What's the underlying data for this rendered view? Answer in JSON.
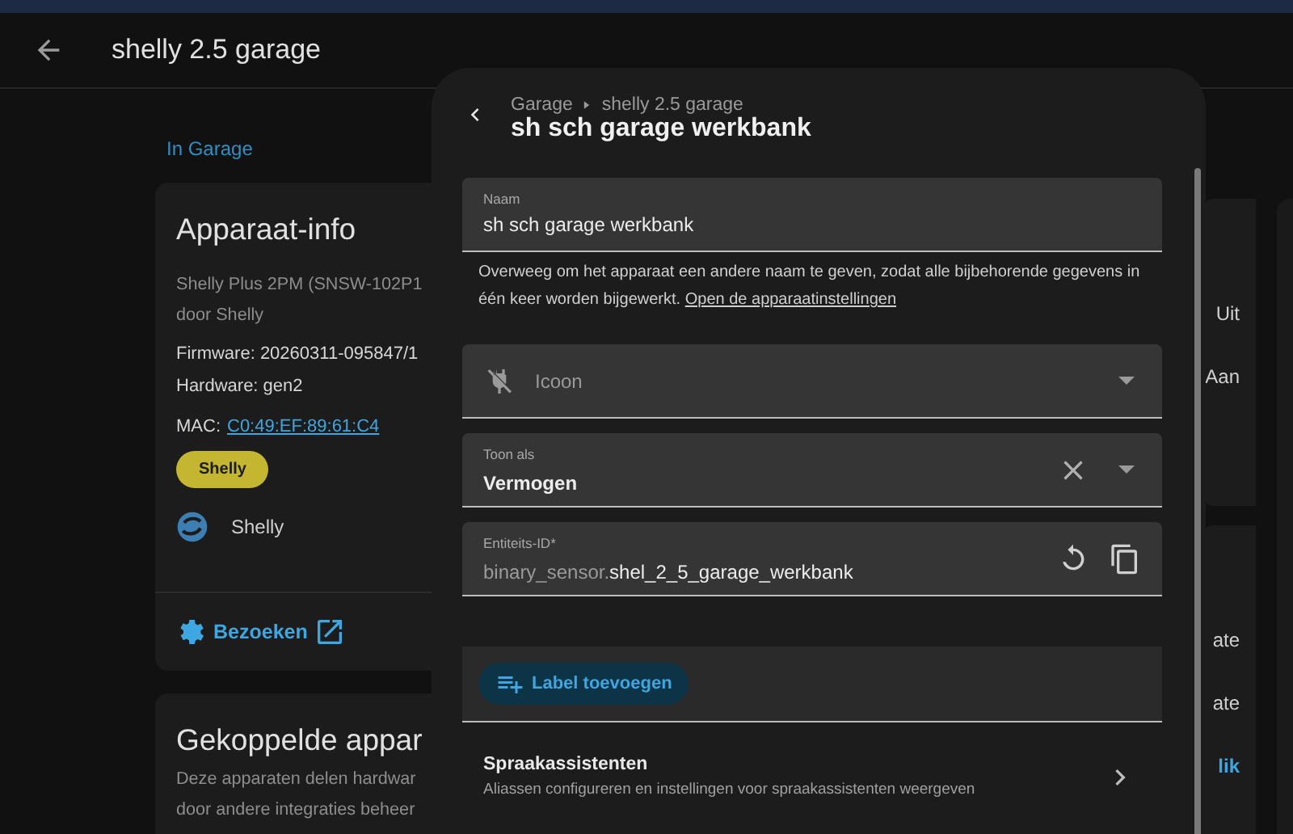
{
  "top_bar": {
    "title": "shelly 2.5 garage"
  },
  "breadcrumb_link": "In Garage",
  "device_info": {
    "title": "Apparaat-info",
    "model": "Shelly Plus 2PM (SNSW-102P1",
    "manufacturer": "door Shelly",
    "firmware": "Firmware: 20260311-095847/1",
    "hardware": "Hardware: gen2",
    "mac_label": "MAC:",
    "mac": "C0:49:EF:89:61:C4",
    "chip": "Shelly",
    "integration": "Shelly",
    "visit": "Bezoeken"
  },
  "linked_devices": {
    "title": "Gekoppelde appar",
    "lines": [
      "Deze apparaten delen hardwar",
      "door andere integraties beheer"
    ]
  },
  "right_cards": [
    {
      "rows": [
        {
          "text": "Uit",
          "kind": "text"
        },
        {
          "text": "Aan",
          "kind": "text"
        }
      ]
    },
    {
      "rows": [
        {
          "text": "ate",
          "kind": "text"
        },
        {
          "text": "ate",
          "kind": "text"
        },
        {
          "text": "lik",
          "kind": "link"
        }
      ]
    }
  ],
  "dialog": {
    "breadcrumb": [
      "Garage",
      "shelly 2.5 garage"
    ],
    "title": "sh sch garage werkbank",
    "name_field": {
      "label": "Naam",
      "value": "sh sch garage werkbank",
      "helper": "Overweeg om het apparaat een andere naam te geven, zodat alle bijbehorende gegevens in één keer worden bijgewerkt.",
      "helper_link": "Open de apparaatinstellingen"
    },
    "icon_field": {
      "placeholder": "Icoon"
    },
    "display_field": {
      "label": "Toon als",
      "value": "Vermogen"
    },
    "entity_field": {
      "label": "Entiteits-ID*",
      "prefix": "binary_sensor.",
      "value": "shel_2_5_garage_werkbank"
    },
    "add_label_button": "Label toevoegen",
    "voice_row": {
      "title": "Spraakassistenten",
      "subtitle": "Aliassen configureren en instellingen voor spraakassistenten weergeven"
    }
  }
}
